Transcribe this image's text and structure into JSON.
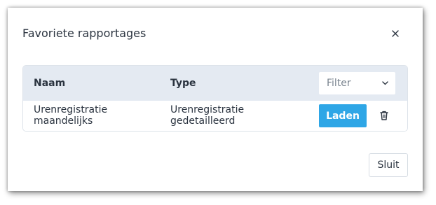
{
  "dialog": {
    "title": "Favoriete rapportages",
    "close_icon": "close-icon",
    "close_button_label": "Sluit"
  },
  "table": {
    "columns": [
      "Naam",
      "Type"
    ],
    "filter": {
      "placeholder": "Filter",
      "icon": "chevron-down-icon"
    },
    "rows": [
      {
        "name": "Urenregistratie maandelijks",
        "type": "Urenregistratie gedetailleerd",
        "load_label": "Laden",
        "delete_icon": "trash-icon"
      }
    ]
  },
  "colors": {
    "accent": "#2ea6e6",
    "header_bg": "#e4eaf2",
    "text": "#2b3440"
  }
}
